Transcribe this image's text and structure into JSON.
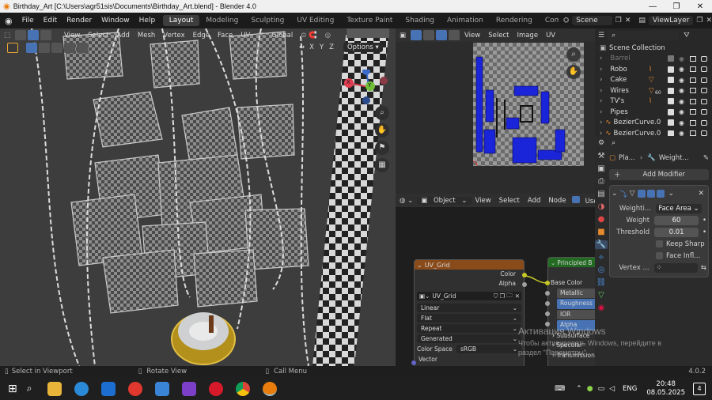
{
  "titlebar": {
    "title": "Birthday_Art [C:\\Users\\agr51sis\\Documents\\Birthday_Art.blend] - Blender 4.0",
    "minimize": "—",
    "maximize": "❐",
    "close": "✕"
  },
  "menubar": {
    "items": [
      "File",
      "Edit",
      "Render",
      "Window",
      "Help"
    ],
    "workspaces": [
      "Layout",
      "Modeling",
      "Sculpting",
      "UV Editing",
      "Texture Paint",
      "Shading",
      "Animation",
      "Rendering",
      "Compositing"
    ],
    "active_workspace": "Layout",
    "scene": "Scene",
    "view_layer": "ViewLayer"
  },
  "viewport_header": {
    "menus": [
      "View",
      "Select",
      "Add",
      "Mesh",
      "Vertex",
      "Edge",
      "Face",
      "UV"
    ],
    "transform": "Global",
    "axes": [
      "X",
      "Y",
      "Z"
    ],
    "options": "Options"
  },
  "gizmo": {
    "x": "X",
    "y": "Y",
    "z": "Z"
  },
  "uv_header": {
    "menus": [
      "View",
      "Select",
      "Image",
      "UV"
    ]
  },
  "outliner": {
    "title": "Scene Collection",
    "items": [
      {
        "name": "Barrel"
      },
      {
        "name": "Robo"
      },
      {
        "name": "Cake"
      },
      {
        "name": "Wires",
        "badge": "60"
      },
      {
        "name": "TV's"
      },
      {
        "name": "Pipes"
      },
      {
        "name": "BezierCurve.0"
      },
      {
        "name": "BezierCurve.0"
      }
    ]
  },
  "properties": {
    "object": "Pla...",
    "modifier": "Weight...",
    "add_modifier": "Add Modifier",
    "rows": [
      {
        "label": "Weighti...",
        "value": "Face Area"
      },
      {
        "label": "Weight",
        "value": "60"
      },
      {
        "label": "Threshold",
        "value": "0.01"
      }
    ],
    "checks": [
      "Keep Sharp",
      "Face Infl..."
    ],
    "vertex_label": "Vertex ..."
  },
  "node_header": {
    "mode": "Object",
    "menus": [
      "View",
      "Select",
      "Add",
      "Node"
    ],
    "use": "Use"
  },
  "node_uv": {
    "title": "UV_Grid",
    "out_color": "Color",
    "out_alpha": "Alpha",
    "image": "UV_Grid",
    "interp": "Linear",
    "proj": "Flat",
    "ext": "Repeat",
    "source": "Generated",
    "cs_label": "Color Space",
    "cs_value": "sRGB",
    "vector": "Vector"
  },
  "node_bsdf": {
    "title": "Principled B",
    "inputs": [
      "Base Color",
      "Metallic",
      "Roughness",
      "IOR",
      "Alpha"
    ],
    "subsurface": "Subsurface",
    "specular": "Specular",
    "transmission": "Transmission"
  },
  "watermark": {
    "line1": "Активация Windows",
    "line2": "Чтобы активировать Windows, перейдите в",
    "line3": "раздел \"Параметры\"."
  },
  "statusbar": {
    "select": "Select in Viewport",
    "rotate": "Rotate View",
    "menu": "Call Menu",
    "version": "4.0.2"
  },
  "taskbar": {
    "lang": "ENG",
    "time": "20:48",
    "date": "08.05.2025",
    "notif": "4"
  }
}
